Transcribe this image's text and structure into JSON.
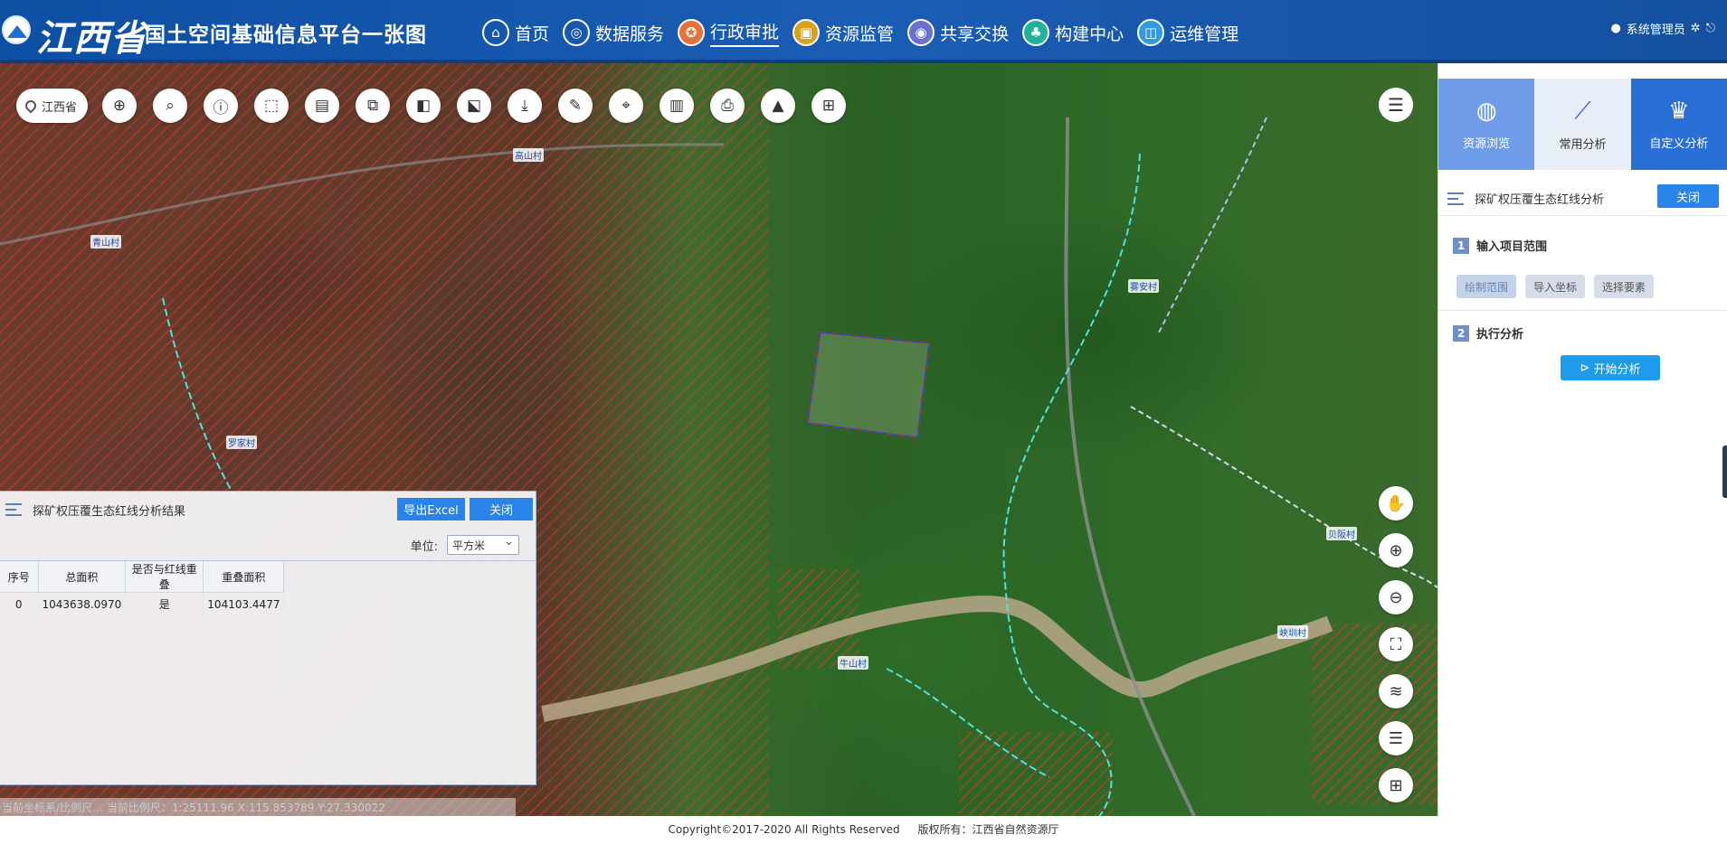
{
  "header": {
    "province": "江西省",
    "platform": "国土空间基础信息平台一张图",
    "nav": [
      {
        "label": "首页",
        "icon": "home-icon",
        "glyph": "⌂"
      },
      {
        "label": "数据服务",
        "icon": "data-service-icon",
        "glyph": "◎"
      },
      {
        "label": "行政审批",
        "icon": "admin-approval-icon",
        "glyph": "✪",
        "active": true
      },
      {
        "label": "资源监管",
        "icon": "resource-supervision-icon",
        "glyph": "▣"
      },
      {
        "label": "共享交换",
        "icon": "share-exchange-icon",
        "glyph": "◉"
      },
      {
        "label": "构建中心",
        "icon": "build-center-icon",
        "glyph": "♣"
      },
      {
        "label": "运维管理",
        "icon": "ops-management-icon",
        "glyph": "◫"
      }
    ],
    "user": "系统管理员"
  },
  "map": {
    "region": "江西省",
    "villages": [
      "高山村",
      "青山村",
      "罗家村",
      "雾安村",
      "贝阪村",
      "峡圳村",
      "牛山村"
    ],
    "toolbar": [
      "query-icon",
      "search-icon",
      "info-icon",
      "select-icon",
      "document-icon",
      "layers-copy-icon",
      "compare-icon",
      "edit-select-icon",
      "download-icon",
      "measure-icon",
      "locate-icon",
      "split-view-icon",
      "print-icon",
      "clear-icon",
      "grid-icon"
    ]
  },
  "panel": {
    "tabs": [
      {
        "label": "资源浏览",
        "icon": "globe-icon",
        "glyph": "◍"
      },
      {
        "label": "常用分析",
        "icon": "analysis-chart-icon",
        "glyph": "⟋"
      },
      {
        "label": "自定义分析",
        "icon": "crown-icon",
        "glyph": "♛"
      }
    ],
    "title": "探矿权压覆生态红线分析",
    "close": "关闭",
    "step1": {
      "num": "1",
      "label": "输入项目范围"
    },
    "step1_buttons": [
      "绘制范围",
      "导入坐标",
      "选择要素"
    ],
    "step2": {
      "num": "2",
      "label": "执行分析"
    },
    "start": "开始分析"
  },
  "result": {
    "title": "探矿权压覆生态红线分析结果",
    "export": "导出Excel",
    "close": "关闭",
    "unit_label": "单位:",
    "unit_value": "平方米",
    "columns": [
      "序号",
      "总面积",
      "是否与红线重叠",
      "重叠面积"
    ],
    "rows": [
      [
        "0",
        "1043638.0970",
        "是",
        "104103.4477"
      ]
    ]
  },
  "status": {
    "faint": "当前坐标系/比例尺…          当前比例尺：1:25111.96        X:115.853789     Y:27.330022"
  },
  "footer": {
    "copyright": "Copyright©2017-2020 All Rights Reserved",
    "owner": "版权所有：江西省自然资源厅"
  }
}
